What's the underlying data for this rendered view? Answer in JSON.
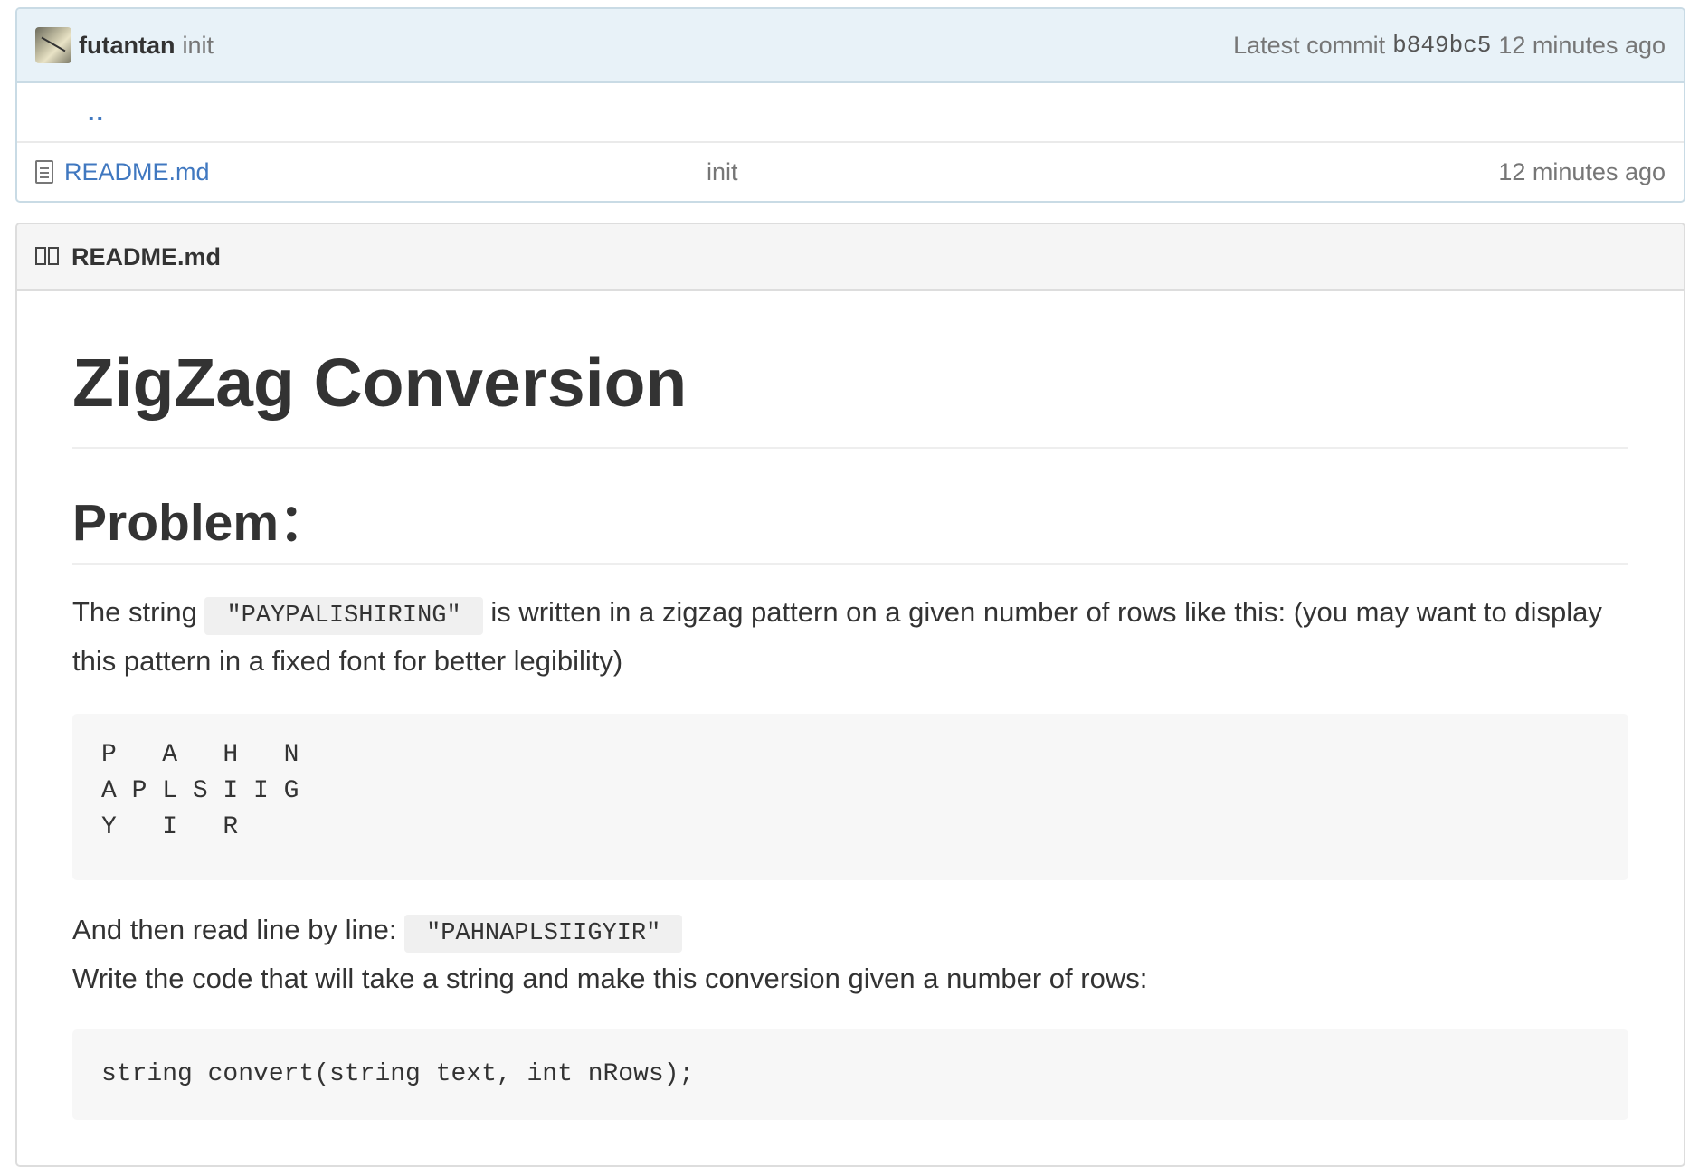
{
  "commit_bar": {
    "author": "futantan",
    "message": "init",
    "latest_label": "Latest commit",
    "sha": "b849bc5",
    "time": "12 minutes ago"
  },
  "files": {
    "parent_link": "..",
    "rows": [
      {
        "name": "README.md",
        "message": "init",
        "time": "12 minutes ago"
      }
    ]
  },
  "readme": {
    "header": "README.md",
    "title": "ZigZag Conversion",
    "problem_heading": "Problem：",
    "intro_before": "The string ",
    "intro_code": "\"PAYPALISHIRING\"",
    "intro_after": " is written in a zigzag pattern on a given number of rows like this: (you may want to display this pattern in a fixed font for better legibility)",
    "pattern": "P   A   H   N\nA P L S I I G\nY   I   R",
    "read_before": "And then read line by line: ",
    "read_code": "\"PAHNAPLSIIGYIR\"",
    "write_text": "Write the code that will take a string and make this conversion given a number of rows:",
    "signature": "string convert(string text, int nRows);"
  }
}
